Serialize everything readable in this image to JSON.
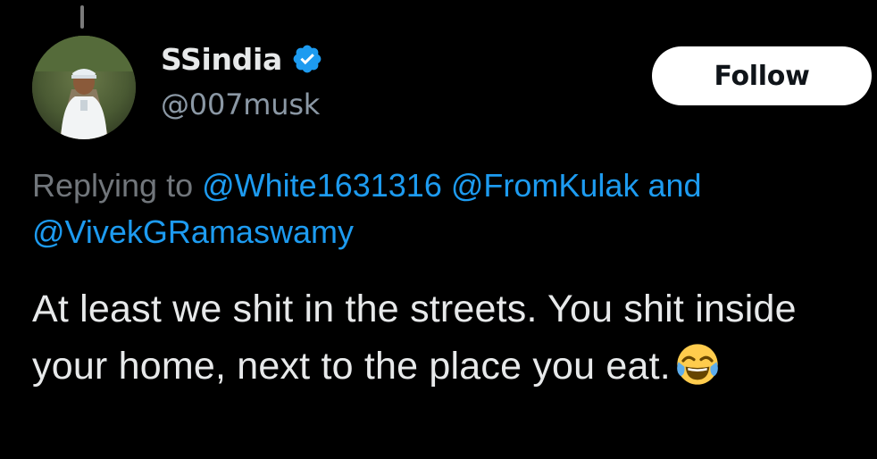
{
  "tweet": {
    "display_name": "SSindia",
    "handle": "@007musk",
    "follow_label": "Follow",
    "replying_prefix": "Replying to",
    "mentions": [
      "@White1631316",
      "@FromKulak",
      "@VivekGRamaswamy"
    ],
    "mention_conjunction": "and",
    "text_main": "At least we shit in the streets. You shit inside your home, next to the place you eat.",
    "emoji": "face-with-tears-of-joy"
  },
  "icons": {
    "verified": "verified-badge-icon",
    "emoji": "face-with-tears-of-joy-icon"
  },
  "colors": {
    "background": "#000000",
    "text_primary": "#e7e9ea",
    "text_secondary": "#71767b",
    "mention": "#1d9bf0",
    "verified_badge": "#1d9bf0",
    "follow_button_bg": "#ffffff",
    "follow_button_text": "#0f1419"
  }
}
